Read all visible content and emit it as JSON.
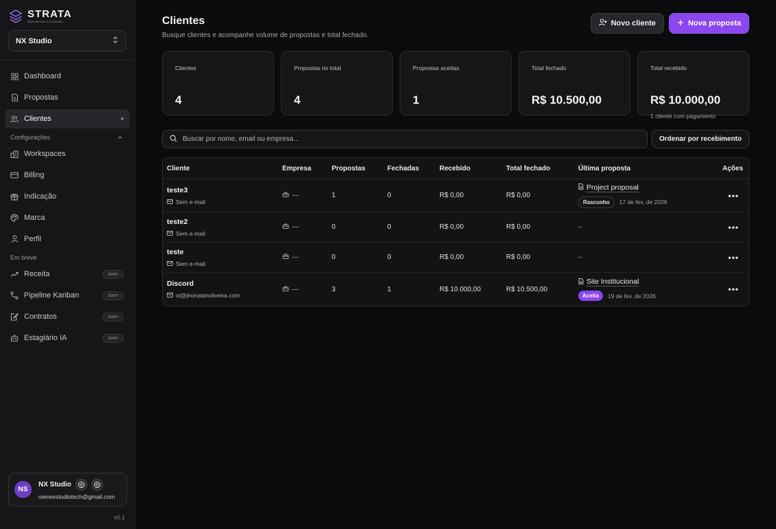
{
  "brand": {
    "name": "STRATA",
    "tagline": "Operate like a company."
  },
  "workspace": {
    "selected": "NX Studio"
  },
  "nav": {
    "main": [
      {
        "label": "Dashboard",
        "icon": "grid-icon"
      },
      {
        "label": "Propostas",
        "icon": "document-icon"
      },
      {
        "label": "Clientes",
        "icon": "users-icon"
      }
    ],
    "settings_section": "Configurações",
    "settings": [
      {
        "label": "Workspaces",
        "icon": "building-icon"
      },
      {
        "label": "Billing",
        "icon": "card-icon"
      },
      {
        "label": "Indicação",
        "icon": "gift-icon"
      },
      {
        "label": "Marca",
        "icon": "palette-icon"
      },
      {
        "label": "Perfil",
        "icon": "user-icon"
      }
    ],
    "soon_section": "Em breve",
    "soon_badge": "soon",
    "soon": [
      {
        "label": "Receita",
        "icon": "trend-icon"
      },
      {
        "label": "Pipeline Kanban",
        "icon": "pipeline-icon"
      },
      {
        "label": "Contratos",
        "icon": "contract-icon"
      },
      {
        "label": "Estagiário IA",
        "icon": "bot-icon"
      }
    ]
  },
  "user": {
    "initials": "NS",
    "name": "NX Studio",
    "email": "oienexstudiotech@gmail.com"
  },
  "version": "v0.1",
  "page": {
    "title": "Clientes",
    "subtitle": "Busque clientes e acompanhe volume de propostas e total fechado.",
    "new_client": "Novo cliente",
    "new_proposal": "Nova proposta"
  },
  "stats": [
    {
      "label": "Clientes",
      "value": "4",
      "note": ""
    },
    {
      "label": "Propostas no total",
      "value": "4",
      "note": ""
    },
    {
      "label": "Propostas aceitas",
      "value": "1",
      "note": ""
    },
    {
      "label": "Total fechado",
      "value": "R$ 10.500,00",
      "note": ""
    },
    {
      "label": "Total recebido",
      "value": "R$ 10.000,00",
      "note": "1 cliente com pagamento"
    }
  ],
  "search": {
    "placeholder": "Buscar por nome, email ou empresa...",
    "sort_label": "Ordenar por recebimento"
  },
  "table": {
    "headers": [
      "Cliente",
      "Empresa",
      "Propostas",
      "Fechadas",
      "Recebido",
      "Total fechado",
      "Última proposta",
      "Ações"
    ],
    "rows": [
      {
        "name": "teste3",
        "email": "Sem e-mail",
        "company": "—",
        "proposals": "1",
        "closed": "0",
        "received": "R$ 0,00",
        "total": "R$ 0,00",
        "last_title": "Project proposal",
        "last_status": "Rascunho",
        "last_date": "17 de fev. de 2026"
      },
      {
        "name": "teste2",
        "email": "Sem e-mail",
        "company": "—",
        "proposals": "0",
        "closed": "0",
        "received": "R$ 0,00",
        "total": "R$ 0,00",
        "last_empty": "–"
      },
      {
        "name": "teste",
        "email": "Sem e-mail",
        "company": "—",
        "proposals": "0",
        "closed": "0",
        "received": "R$ 0,00",
        "total": "R$ 0,00",
        "last_empty": "–"
      },
      {
        "name": "Discord",
        "email": "oi@jhonatanoliveira.com",
        "company": "—",
        "proposals": "3",
        "closed": "1",
        "received": "R$ 10.000,00",
        "total": "R$ 10.500,00",
        "last_title": "Site Institucional",
        "last_status": "Aceita",
        "last_date": "19 de fev. de 2026"
      }
    ],
    "actions_glyph": "•••"
  },
  "colors": {
    "accent": "#8b46f0",
    "background": "#0b0b0d",
    "sidebar": "#161618"
  }
}
